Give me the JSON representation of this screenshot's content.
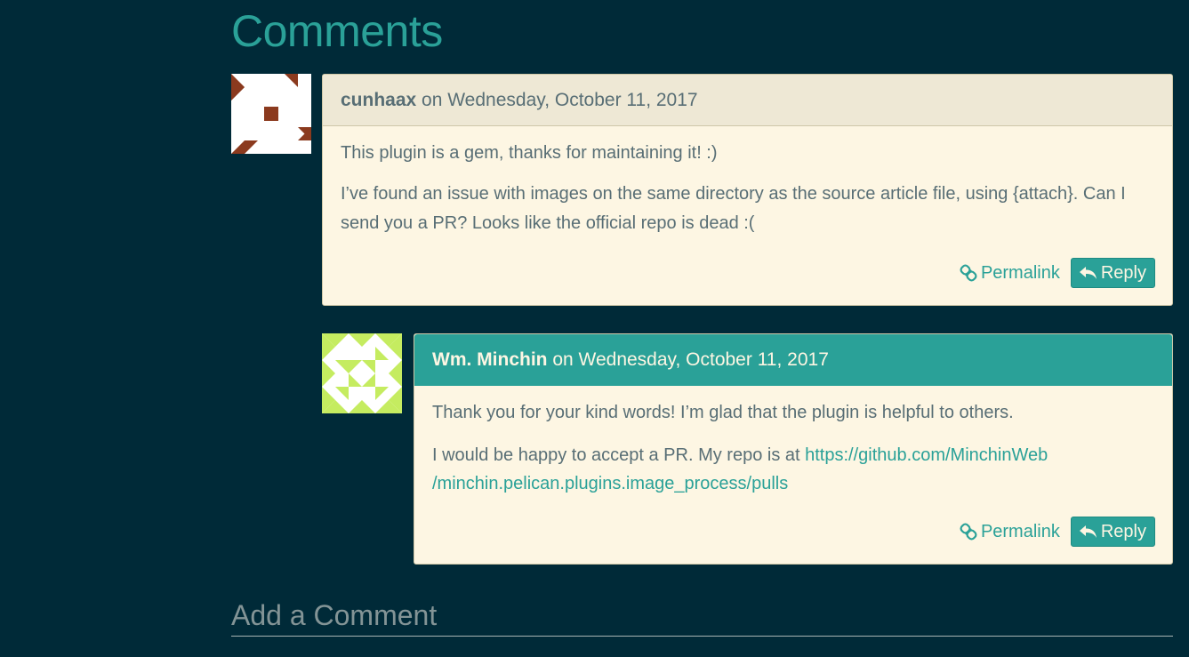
{
  "section_title": "Comments",
  "comments": [
    {
      "author": "cunhaax",
      "date_text": " on Wednesday, October 11, 2017",
      "paragraphs": [
        "This plugin is a gem, thanks for maintaining it! :)",
        "I’ve found an issue with images on the same directory as the source article file, using {attach}. Can I send you a PR? Looks like the official repo is dead :("
      ],
      "permalink_label": "Permalink",
      "reply_label": "Reply",
      "avatar_color": "#8b3a1e"
    },
    {
      "author": "Wm. Minchin",
      "date_text": " on Wednesday, October 11, 2017",
      "paragraph1": "Thank you for your kind words! I’m glad that the plugin is helpful to others.",
      "paragraph2_prefix": "I would be happy to accept a PR. My repo is at ",
      "link_line1": "https://github.com/MinchinWeb",
      "link_line2": "/minchin.pelican.plugins.image_process/pulls",
      "permalink_label": "Permalink",
      "reply_label": "Reply",
      "avatar_color": "#c5ec60"
    }
  ],
  "add_comment_title": "Add a Comment",
  "colors": {
    "background": "#002a38",
    "accent": "#2aa198",
    "card": "#fdf6e3",
    "card_header": "#eee8d5",
    "text": "#586e75"
  },
  "icons": [
    "link-icon",
    "reply-icon"
  ]
}
